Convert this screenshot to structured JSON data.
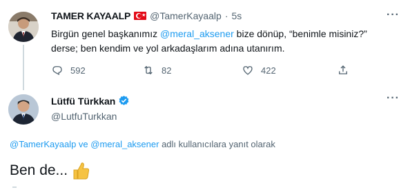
{
  "tweet1": {
    "name": "TAMER KAYAALP",
    "handle": "@TamerKayaalp",
    "separator": "·",
    "time": "5s",
    "more": "···",
    "text_before": "Birgün genel başkanımız ",
    "mention": "@meral_aksener",
    "text_after": " bize dönüp, “benimle misiniz?” derse; ben kendim ve yol arkadaşlarım adına utanırım.",
    "reply_count": "592",
    "retweet_count": "82",
    "like_count": "422"
  },
  "tweet2": {
    "name": "Lütfü Türkkan",
    "handle": "@LutfuTurkkan",
    "more": "···",
    "mention_1": "@TamerKayaalp",
    "connector": " ve ",
    "mention_2": "@meral_aksener",
    "reply_suffix": " adlı kullanıcılara yanıt olarak",
    "text": "Ben de..."
  },
  "colors": {
    "accent": "#1d9bf0",
    "muted": "#536471",
    "text": "#0f1419",
    "flag_red": "#e30a17",
    "thumb_yellow": "#f6c343"
  },
  "icons": [
    "flag-turkey-icon",
    "reply-icon",
    "retweet-icon",
    "like-icon",
    "share-icon",
    "verified-icon",
    "thumbs-up-icon",
    "more-icon"
  ]
}
